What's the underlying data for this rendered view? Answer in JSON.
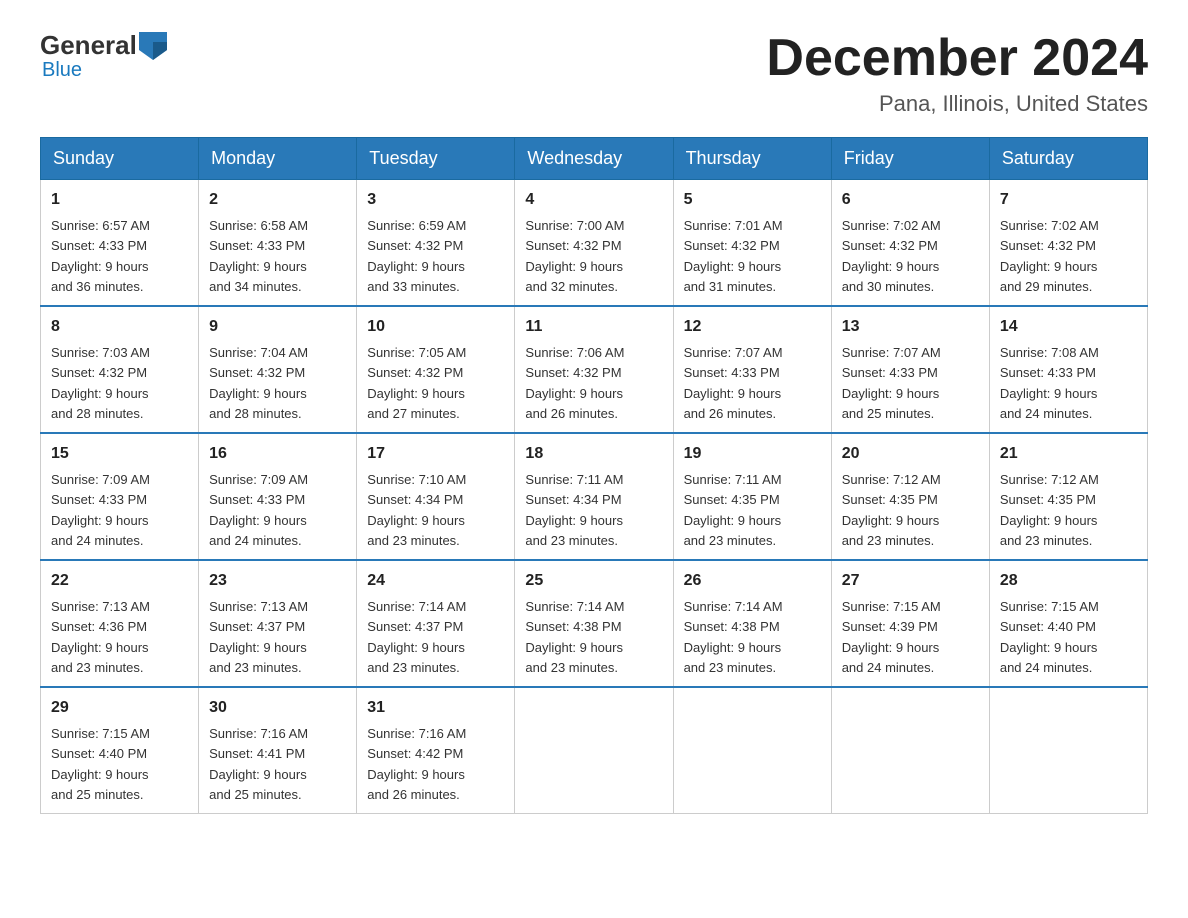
{
  "logo": {
    "part1": "General",
    "part2": "Blue"
  },
  "header": {
    "title": "December 2024",
    "subtitle": "Pana, Illinois, United States"
  },
  "days_of_week": [
    "Sunday",
    "Monday",
    "Tuesday",
    "Wednesday",
    "Thursday",
    "Friday",
    "Saturday"
  ],
  "weeks": [
    [
      {
        "day": "1",
        "sunrise": "6:57 AM",
        "sunset": "4:33 PM",
        "daylight": "9 hours and 36 minutes."
      },
      {
        "day": "2",
        "sunrise": "6:58 AM",
        "sunset": "4:33 PM",
        "daylight": "9 hours and 34 minutes."
      },
      {
        "day": "3",
        "sunrise": "6:59 AM",
        "sunset": "4:32 PM",
        "daylight": "9 hours and 33 minutes."
      },
      {
        "day": "4",
        "sunrise": "7:00 AM",
        "sunset": "4:32 PM",
        "daylight": "9 hours and 32 minutes."
      },
      {
        "day": "5",
        "sunrise": "7:01 AM",
        "sunset": "4:32 PM",
        "daylight": "9 hours and 31 minutes."
      },
      {
        "day": "6",
        "sunrise": "7:02 AM",
        "sunset": "4:32 PM",
        "daylight": "9 hours and 30 minutes."
      },
      {
        "day": "7",
        "sunrise": "7:02 AM",
        "sunset": "4:32 PM",
        "daylight": "9 hours and 29 minutes."
      }
    ],
    [
      {
        "day": "8",
        "sunrise": "7:03 AM",
        "sunset": "4:32 PM",
        "daylight": "9 hours and 28 minutes."
      },
      {
        "day": "9",
        "sunrise": "7:04 AM",
        "sunset": "4:32 PM",
        "daylight": "9 hours and 28 minutes."
      },
      {
        "day": "10",
        "sunrise": "7:05 AM",
        "sunset": "4:32 PM",
        "daylight": "9 hours and 27 minutes."
      },
      {
        "day": "11",
        "sunrise": "7:06 AM",
        "sunset": "4:32 PM",
        "daylight": "9 hours and 26 minutes."
      },
      {
        "day": "12",
        "sunrise": "7:07 AM",
        "sunset": "4:33 PM",
        "daylight": "9 hours and 26 minutes."
      },
      {
        "day": "13",
        "sunrise": "7:07 AM",
        "sunset": "4:33 PM",
        "daylight": "9 hours and 25 minutes."
      },
      {
        "day": "14",
        "sunrise": "7:08 AM",
        "sunset": "4:33 PM",
        "daylight": "9 hours and 24 minutes."
      }
    ],
    [
      {
        "day": "15",
        "sunrise": "7:09 AM",
        "sunset": "4:33 PM",
        "daylight": "9 hours and 24 minutes."
      },
      {
        "day": "16",
        "sunrise": "7:09 AM",
        "sunset": "4:33 PM",
        "daylight": "9 hours and 24 minutes."
      },
      {
        "day": "17",
        "sunrise": "7:10 AM",
        "sunset": "4:34 PM",
        "daylight": "9 hours and 23 minutes."
      },
      {
        "day": "18",
        "sunrise": "7:11 AM",
        "sunset": "4:34 PM",
        "daylight": "9 hours and 23 minutes."
      },
      {
        "day": "19",
        "sunrise": "7:11 AM",
        "sunset": "4:35 PM",
        "daylight": "9 hours and 23 minutes."
      },
      {
        "day": "20",
        "sunrise": "7:12 AM",
        "sunset": "4:35 PM",
        "daylight": "9 hours and 23 minutes."
      },
      {
        "day": "21",
        "sunrise": "7:12 AM",
        "sunset": "4:35 PM",
        "daylight": "9 hours and 23 minutes."
      }
    ],
    [
      {
        "day": "22",
        "sunrise": "7:13 AM",
        "sunset": "4:36 PM",
        "daylight": "9 hours and 23 minutes."
      },
      {
        "day": "23",
        "sunrise": "7:13 AM",
        "sunset": "4:37 PM",
        "daylight": "9 hours and 23 minutes."
      },
      {
        "day": "24",
        "sunrise": "7:14 AM",
        "sunset": "4:37 PM",
        "daylight": "9 hours and 23 minutes."
      },
      {
        "day": "25",
        "sunrise": "7:14 AM",
        "sunset": "4:38 PM",
        "daylight": "9 hours and 23 minutes."
      },
      {
        "day": "26",
        "sunrise": "7:14 AM",
        "sunset": "4:38 PM",
        "daylight": "9 hours and 23 minutes."
      },
      {
        "day": "27",
        "sunrise": "7:15 AM",
        "sunset": "4:39 PM",
        "daylight": "9 hours and 24 minutes."
      },
      {
        "day": "28",
        "sunrise": "7:15 AM",
        "sunset": "4:40 PM",
        "daylight": "9 hours and 24 minutes."
      }
    ],
    [
      {
        "day": "29",
        "sunrise": "7:15 AM",
        "sunset": "4:40 PM",
        "daylight": "9 hours and 25 minutes."
      },
      {
        "day": "30",
        "sunrise": "7:16 AM",
        "sunset": "4:41 PM",
        "daylight": "9 hours and 25 minutes."
      },
      {
        "day": "31",
        "sunrise": "7:16 AM",
        "sunset": "4:42 PM",
        "daylight": "9 hours and 26 minutes."
      },
      null,
      null,
      null,
      null
    ]
  ],
  "labels": {
    "sunrise": "Sunrise:",
    "sunset": "Sunset:",
    "daylight": "Daylight:"
  }
}
